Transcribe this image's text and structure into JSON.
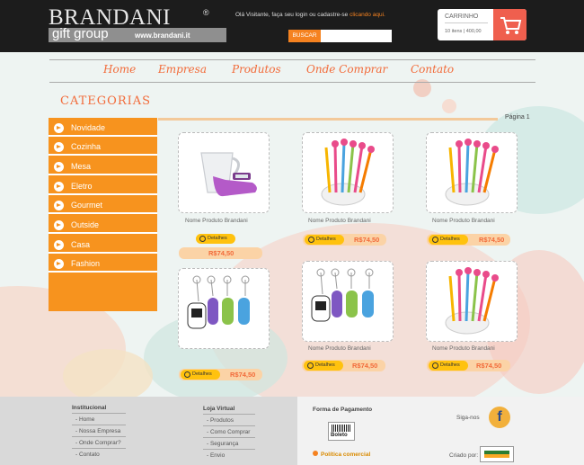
{
  "header": {
    "logo_main": "BRANDANI",
    "logo_reg": "®",
    "logo_sub": "gift group",
    "logo_url": "www.brandani.it",
    "welcome_text": "Olá Visitante, faça seu login ou cadastre-se",
    "welcome_link": "clicando aqui.",
    "search_button": "BUSCAR",
    "search_value": ""
  },
  "cart": {
    "title": "CARRINHO",
    "info": "10 itens  | 400,00",
    "icon": "shopping-cart-icon"
  },
  "nav": {
    "items": [
      "Home",
      "Empresa",
      "Produtos",
      "Onde Comprar",
      "Contato"
    ]
  },
  "categories": {
    "title": "CATEGORIAS",
    "items": [
      "Novidade",
      "Cozinha",
      "Mesa",
      "Eletro",
      "Gourmet",
      "Outside",
      "Casa",
      "Fashion"
    ]
  },
  "pagination": {
    "label": "Página 1"
  },
  "products": [
    {
      "name": "Nome  Produto Brandani",
      "details": "Detalhes",
      "price": "R$74,50",
      "image": "measuring-cup-scale"
    },
    {
      "name": "Nome  Produto Brandani",
      "details": "Detalhes",
      "price": "R$74,50",
      "image": "straws-cup"
    },
    {
      "name": "Nome  Produto Brandani",
      "details": "Detalhes",
      "price": "R$74,50",
      "image": "straws-cup"
    },
    {
      "name": "",
      "details": "Detalhes",
      "price": "R$74,50",
      "image": "keychains"
    },
    {
      "name": "Nome  Produto Brandani",
      "details": "Detalhes",
      "price": "R$74,50",
      "image": "keychains"
    },
    {
      "name": "Nome  Produto Brandani",
      "details": "Detalhes",
      "price": "R$74,50",
      "image": "straws-cup"
    }
  ],
  "footer": {
    "institucional_title": "Institucional",
    "institucional_links": [
      "- Home",
      "- Nossa Empresa",
      "- Onde Comprar?",
      "- Contato"
    ],
    "loja_title": "Loja Virtual",
    "loja_links": [
      "- Produtos",
      "- Como Comprar",
      "- Segurança",
      "- Envio"
    ],
    "payment_title": "Forma de Pagamento",
    "boleto_label": "Boleto",
    "policy_link": "Política comercial",
    "follow": "Siga-nos",
    "created_by": "Criado por:",
    "facebook_icon": "facebook-icon"
  },
  "colors": {
    "accent": "#f58220",
    "category": "#f7931e",
    "nav_text": "#f26b3a",
    "header_bg": "#1c1c1c",
    "cart_red": "#ef5f4e",
    "button_yellow": "#ffc20e"
  }
}
